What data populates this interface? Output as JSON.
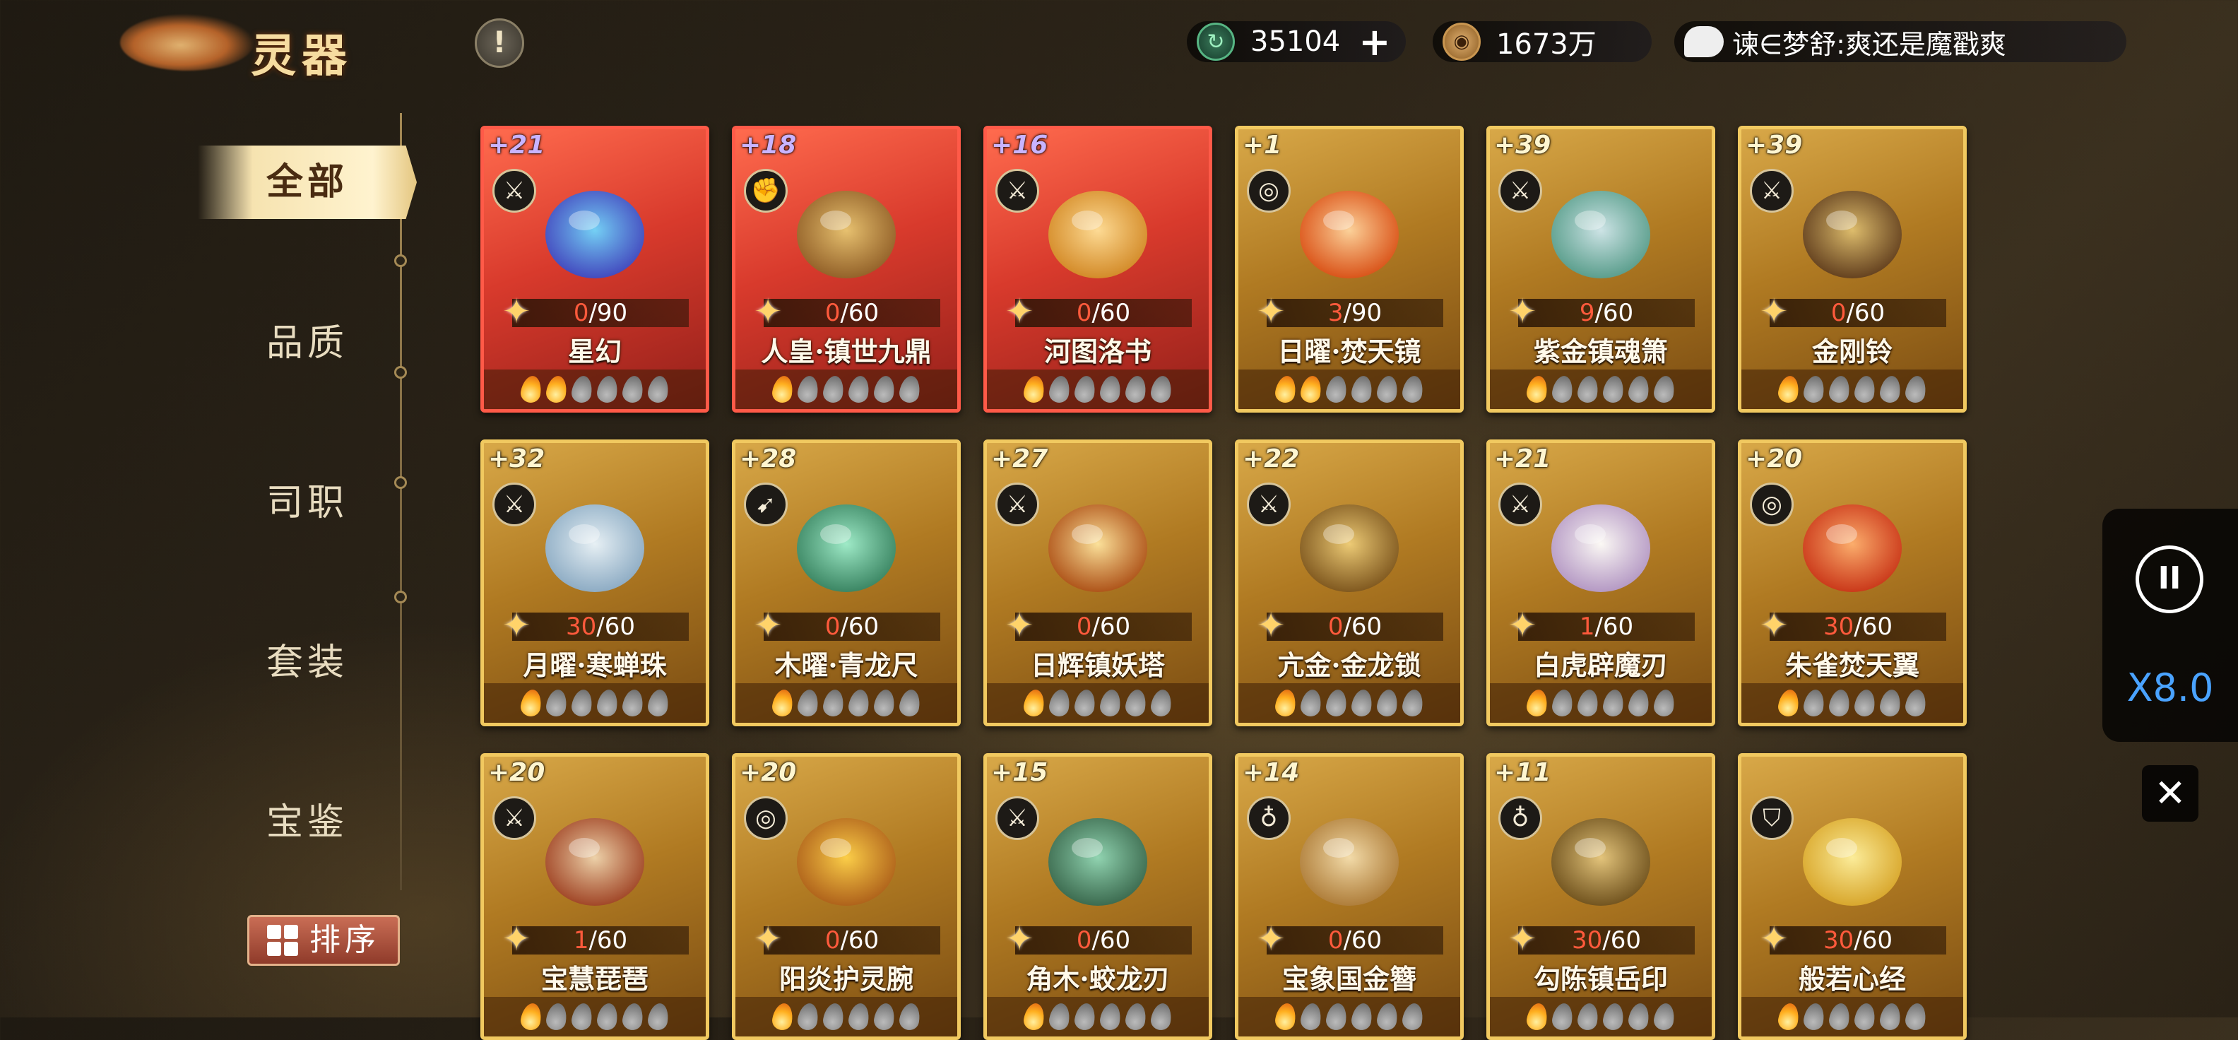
{
  "header": {
    "title": "灵器",
    "info_label": "!",
    "jade_amount": "35104",
    "jade_plus": "+",
    "coin_amount": "1673万",
    "coin_icon_glyph": "◉",
    "jade_icon_glyph": "↻",
    "chat_message": "谏∈梦舒:爽还是魔戳爽"
  },
  "sidebar": {
    "items": [
      {
        "label": "全部",
        "active": true
      },
      {
        "label": "品质",
        "active": false
      },
      {
        "label": "司职",
        "active": false
      },
      {
        "label": "套装",
        "active": false
      },
      {
        "label": "宝鉴",
        "active": false
      }
    ],
    "sort_label": "排序"
  },
  "cards": [
    {
      "level": "+21",
      "role": "sword",
      "exp": "0",
      "max": "/90",
      "name": "星幻",
      "flames_lit": 2,
      "red": true,
      "art": "blue-deer-mask"
    },
    {
      "level": "+18",
      "role": "fist",
      "exp": "0",
      "max": "/60",
      "name": "人皇·镇世九鼎",
      "flames_lit": 1,
      "red": true,
      "art": "bronze-cauldron"
    },
    {
      "level": "+16",
      "role": "sword",
      "exp": "0",
      "max": "/60",
      "name": "河图洛书",
      "flames_lit": 1,
      "red": true,
      "art": "golden-scroll"
    },
    {
      "level": "+1",
      "role": "swirl",
      "exp": "3",
      "max": "/90",
      "name": "日曜·焚天镜",
      "flames_lit": 2,
      "red": false,
      "art": "fire-mirror"
    },
    {
      "level": "+39",
      "role": "sword",
      "exp": "9",
      "max": "/60",
      "name": "紫金镇魂箫",
      "flames_lit": 1,
      "red": false,
      "art": "jade-flute"
    },
    {
      "level": "+39",
      "role": "sword",
      "exp": "0",
      "max": "/60",
      "name": "金刚铃",
      "flames_lit": 1,
      "red": false,
      "art": "vajra-bell"
    },
    {
      "level": "+32",
      "role": "sword",
      "exp": "30",
      "max": "/60",
      "name": "月曜·寒蝉珠",
      "flames_lit": 1,
      "red": false,
      "art": "ice-pearl"
    },
    {
      "level": "+28",
      "role": "spear",
      "exp": "0",
      "max": "/60",
      "name": "木曜·青龙尺",
      "flames_lit": 1,
      "red": false,
      "art": "dragon-ruler"
    },
    {
      "level": "+27",
      "role": "sword",
      "exp": "0",
      "max": "/60",
      "name": "日辉镇妖塔",
      "flames_lit": 1,
      "red": false,
      "art": "golden-pagoda"
    },
    {
      "level": "+22",
      "role": "sword",
      "exp": "0",
      "max": "/60",
      "name": "亢金·金龙锁",
      "flames_lit": 1,
      "red": false,
      "art": "dragon-lock"
    },
    {
      "level": "+21",
      "role": "sword",
      "exp": "1",
      "max": "/60",
      "name": "白虎辟魔刃",
      "flames_lit": 1,
      "red": false,
      "art": "white-tiger-blade"
    },
    {
      "level": "+20",
      "role": "swirl",
      "exp": "30",
      "max": "/60",
      "name": "朱雀焚天翼",
      "flames_lit": 1,
      "red": false,
      "art": "phoenix-wings"
    },
    {
      "level": "+20",
      "role": "sword",
      "exp": "1",
      "max": "/60",
      "name": "宝慧琵琶",
      "flames_lit": 1,
      "red": false,
      "art": "pipa"
    },
    {
      "level": "+20",
      "role": "swirl",
      "exp": "0",
      "max": "/60",
      "name": "阳炎护灵腕",
      "flames_lit": 1,
      "red": false,
      "art": "sun-bracelet"
    },
    {
      "level": "+15",
      "role": "sword",
      "exp": "0",
      "max": "/60",
      "name": "角木·蛟龙刃",
      "flames_lit": 1,
      "red": false,
      "art": "jade-sword"
    },
    {
      "level": "+14",
      "role": "gourd",
      "exp": "0",
      "max": "/60",
      "name": "宝象国金簪",
      "flames_lit": 1,
      "red": false,
      "art": "gold-hairpin"
    },
    {
      "level": "+11",
      "role": "gourd",
      "exp": "30",
      "max": "/60",
      "name": "勾陈镇岳印",
      "flames_lit": 1,
      "red": false,
      "art": "beast-seal"
    },
    {
      "level": "",
      "role": "shield",
      "exp": "30",
      "max": "/60",
      "name": "般若心经",
      "flames_lit": 1,
      "red": false,
      "art": "golden-sutra"
    }
  ],
  "role_glyphs": {
    "sword": "⚔",
    "fist": "✊",
    "swirl": "◎",
    "spear": "➹",
    "gourd": "♁",
    "shield": "⛉"
  },
  "controls": {
    "pause_label": "II",
    "speed_label": "X8.0",
    "close_label": "✕"
  },
  "colors": {
    "gold_border": "#f1c960",
    "red_border": "#ff5a48",
    "exp_current": "#ff5a3c",
    "speed_text": "#4aa3ff"
  }
}
